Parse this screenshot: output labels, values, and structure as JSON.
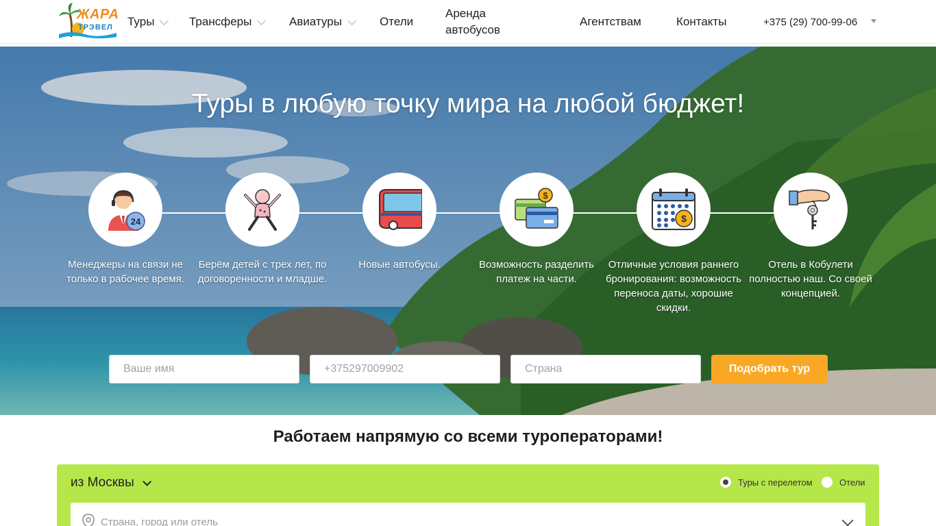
{
  "header": {
    "logo_text_top": "ЖАРА",
    "logo_text_bottom": "ТРЭВЕЛ",
    "nav": [
      {
        "label": "Туры"
      },
      {
        "label": "Трансферы"
      },
      {
        "label": "Авиатуры"
      },
      {
        "label": "Отели"
      },
      {
        "label_line1": "Аренда",
        "label_line2": "автобусов"
      },
      {
        "label": "Агентствам"
      },
      {
        "label": "Контакты"
      }
    ],
    "phone": "+375 (29) 700-99-06"
  },
  "hero": {
    "title": "Туры в любую точку мира на любой бюджет!",
    "features": [
      {
        "icon": "manager-24-icon",
        "text": "Менеджеры на связи не только в рабочее время."
      },
      {
        "icon": "baby-icon",
        "text": "Берём детей с трех лет, по договоренности и младше."
      },
      {
        "icon": "bus-icon",
        "text": "Новые автобусы."
      },
      {
        "icon": "cards-payment-icon",
        "text": "Возможность разделить платеж на части."
      },
      {
        "icon": "calendar-money-icon",
        "text": "Отличные условия раннего бронирования: возможность переноса даты, хорошие скидки."
      },
      {
        "icon": "hand-key-icon",
        "text": "Отель в Кобулети полностью наш. Со своей концепцией."
      }
    ],
    "form": {
      "name_placeholder": "Ваше имя",
      "phone_placeholder": "+375297009902",
      "country_placeholder": "Страна",
      "submit_label": "Подобрать тур"
    }
  },
  "section": {
    "title": "Работаем напрямую со всеми туроператорами!"
  },
  "search": {
    "from_label": "из Москвы",
    "radio_tours": "Туры с перелетом",
    "radio_hotels": "Отели",
    "destination_placeholder": "Страна, город или отель"
  },
  "colors": {
    "accent_orange": "#f9a825",
    "search_green": "#b6e74a"
  }
}
